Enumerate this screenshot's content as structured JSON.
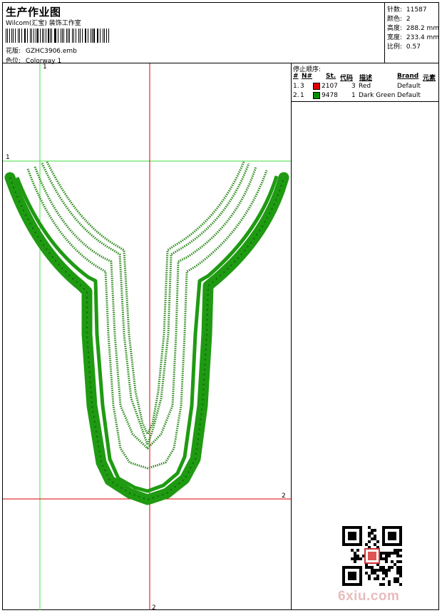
{
  "header": {
    "title": "生产作业图",
    "subtitle": "Wilcom(汇宝) 装饰工作室",
    "design_label": "花版:",
    "design_value": "GZHC3906.emb",
    "colorway_label": "色位:",
    "colorway_value": "Colorway 1"
  },
  "info": {
    "stitches_label": "针数:",
    "stitches_value": "11587",
    "colors_label": "颜色:",
    "colors_value": "2",
    "height_label": "高度:",
    "height_value": "288.2 mm",
    "width_label": "宽度:",
    "width_value": "233.4 mm",
    "scale_label": "比例:",
    "scale_value": "0.57"
  },
  "stop_sequence": {
    "title": "停止顺序:",
    "columns": [
      "#",
      "N#",
      "St.",
      "代码",
      "描述",
      "Brand",
      "元素"
    ],
    "rows": [
      {
        "index": "1.",
        "needle": "3",
        "color": "#e00000",
        "stitches": "2107",
        "code": "3",
        "description": "Red",
        "brand": "Default"
      },
      {
        "index": "2.",
        "needle": "1",
        "color": "#009000",
        "stitches": "9478",
        "code": "1",
        "description": "Dark Green",
        "brand": "Default"
      }
    ]
  },
  "canvas": {
    "green_v_label": "1",
    "green_h_label": "1",
    "red_h_label": "2",
    "red_v_label": "2",
    "green_color": "#1f9a12",
    "zigzag_color": "#2c8a1c",
    "red_guide_color": "#dd0000",
    "green_guide_color": "#44dd44"
  },
  "watermark": "6xiu.com"
}
